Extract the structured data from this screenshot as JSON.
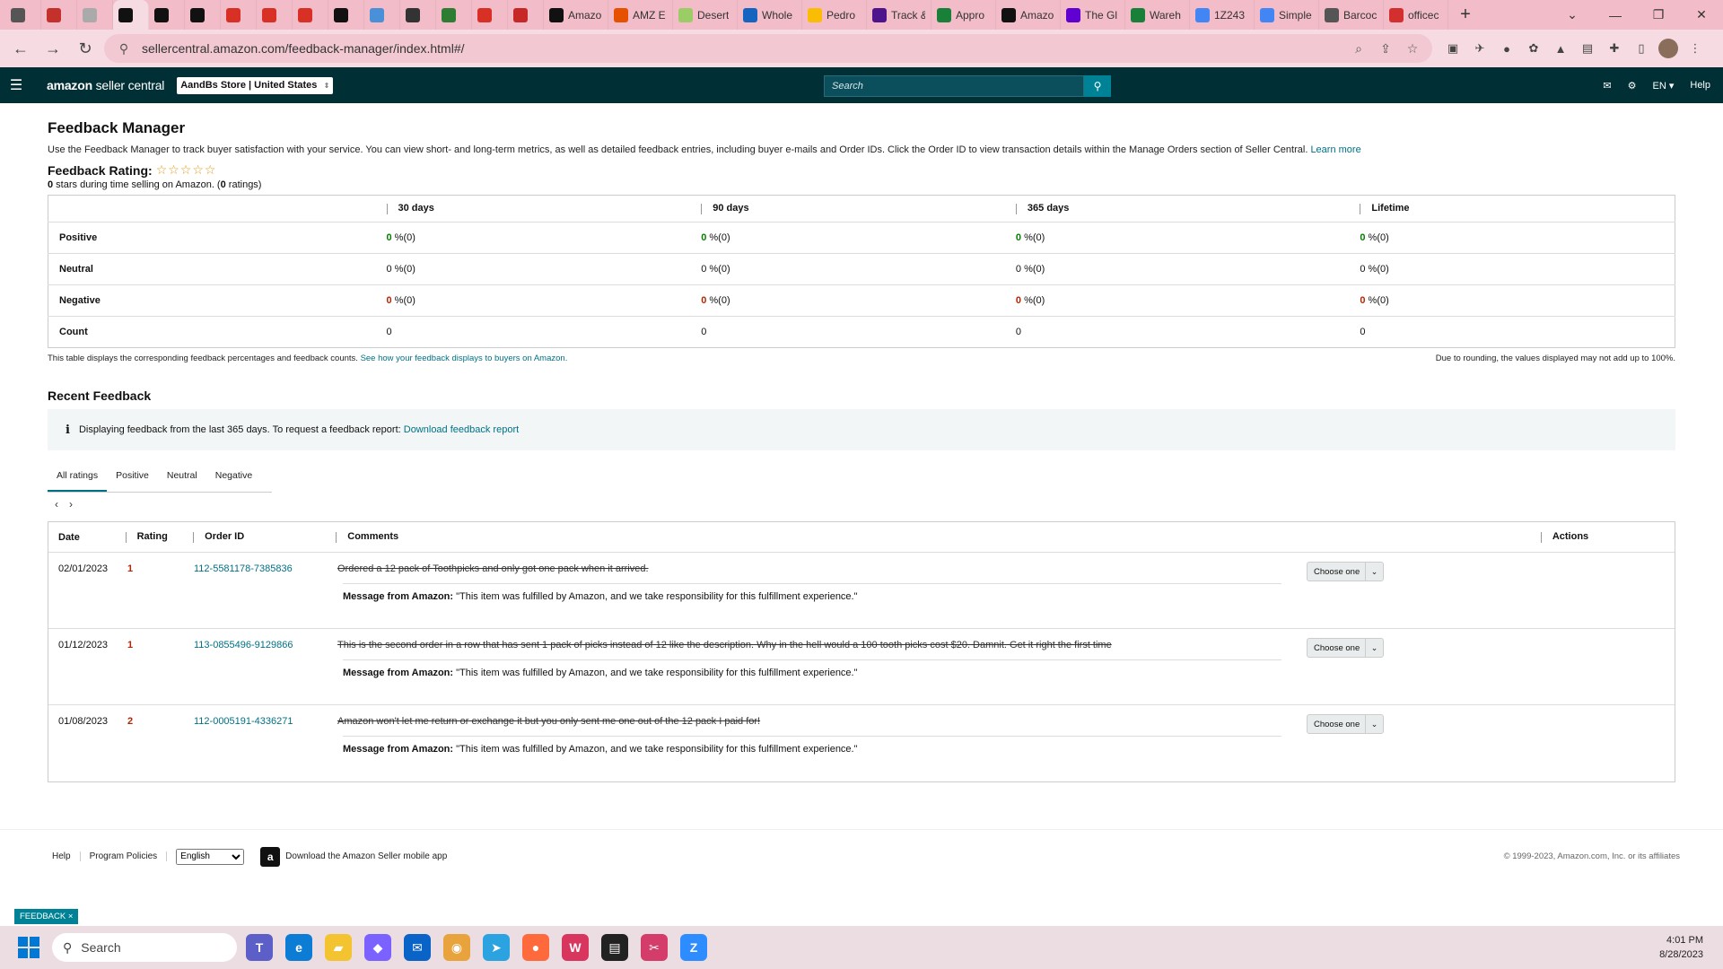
{
  "browser": {
    "tabs": [
      {
        "title": "",
        "icon": "chrome-icon",
        "color": "#555"
      },
      {
        "title": "",
        "icon": "pinterest-like-icon",
        "color": "#c4302b"
      },
      {
        "title": "",
        "icon": "tab-icon",
        "color": "#aaa"
      },
      {
        "title": "",
        "icon": "amazon-icon",
        "color": "#111"
      },
      {
        "title": "",
        "icon": "amazon-icon",
        "color": "#111"
      },
      {
        "title": "",
        "icon": "amazon-icon",
        "color": "#111"
      },
      {
        "title": "",
        "icon": "gmail-icon",
        "color": "#d93025"
      },
      {
        "title": "",
        "icon": "gmail-icon",
        "color": "#d93025"
      },
      {
        "title": "",
        "icon": "gmail-icon",
        "color": "#d93025"
      },
      {
        "title": "",
        "icon": "circle-icon",
        "color": "#111"
      },
      {
        "title": "",
        "icon": "doc-icon",
        "color": "#4a90d9"
      },
      {
        "title": "",
        "icon": "hat-icon",
        "color": "#333"
      },
      {
        "title": "",
        "icon": "leaf-icon",
        "color": "#2e7d32"
      },
      {
        "title": "",
        "icon": "gmail-icon",
        "color": "#d93025"
      },
      {
        "title": "",
        "icon": "box-icon",
        "color": "#c62828"
      },
      {
        "title": "Amazo",
        "icon": "amazon-icon",
        "color": "#111"
      },
      {
        "title": "AMZ E",
        "icon": "pencil-icon",
        "color": "#e65100"
      },
      {
        "title": "Desert",
        "icon": "leaf-icon",
        "color": "#9ccc65"
      },
      {
        "title": "Whole",
        "icon": "windows-icon",
        "color": "#1565c0"
      },
      {
        "title": "Pedro",
        "icon": "drive-icon",
        "color": "#fbbc04"
      },
      {
        "title": "Track &",
        "icon": "fedex-icon",
        "color": "#4d148c"
      },
      {
        "title": "Appro",
        "icon": "sheets-icon",
        "color": "#188038"
      },
      {
        "title": "Amazo",
        "icon": "amazon-icon",
        "color": "#111"
      },
      {
        "title": "The Gl",
        "icon": "yahoo-icon",
        "color": "#6001d2"
      },
      {
        "title": "Wareh",
        "icon": "sheets-icon",
        "color": "#188038"
      },
      {
        "title": "1Z243",
        "icon": "google-icon",
        "color": "#4285f4"
      },
      {
        "title": "Simple",
        "icon": "google-icon",
        "color": "#4285f4"
      },
      {
        "title": "Barcoc",
        "icon": "barcode-icon",
        "color": "#555"
      },
      {
        "title": "officec",
        "icon": "shield-icon",
        "color": "#d32f2f"
      }
    ],
    "url": "sellercentral.amazon.com/feedback-manager/index.html#/"
  },
  "header": {
    "brand_bold": "amazon",
    "brand_rest": " seller central",
    "store": "AandBs Store | United States",
    "search_placeholder": "Search",
    "language": "EN",
    "help": "Help"
  },
  "page": {
    "title": "Feedback Manager",
    "intro": "Use the Feedback Manager to track buyer satisfaction with your service. You can view short- and long-term metrics, as well as detailed feedback entries, including buyer e-mails and Order IDs. Click the Order ID to view transaction details within the Manage Orders section of Seller Central.",
    "learn_more": "Learn more",
    "rating_label": "Feedback Rating:",
    "rating_stars": "☆☆☆☆☆",
    "rating_value": 0,
    "rating_sub_bold": "0",
    "rating_sub_mid": " stars during time selling on Amazon. (",
    "rating_sub_count": "0",
    "rating_sub_end": " ratings)"
  },
  "metrics": {
    "periods": [
      "30 days",
      "90 days",
      "365 days",
      "Lifetime"
    ],
    "rows": [
      {
        "label": "Positive",
        "type": "pos",
        "values": [
          [
            "0",
            " %(0)"
          ],
          [
            "0",
            " %(0)"
          ],
          [
            "0",
            " %(0)"
          ],
          [
            "0",
            " %(0)"
          ]
        ]
      },
      {
        "label": "Neutral",
        "type": "neu",
        "values": [
          [
            "0",
            " %(0)"
          ],
          [
            "0",
            " %(0)"
          ],
          [
            "0",
            " %(0)"
          ],
          [
            "0",
            " %(0)"
          ]
        ]
      },
      {
        "label": "Negative",
        "type": "neg",
        "values": [
          [
            "0",
            " %(0)"
          ],
          [
            "0",
            " %(0)"
          ],
          [
            "0",
            " %(0)"
          ],
          [
            "0",
            " %(0)"
          ]
        ]
      },
      {
        "label": "Count",
        "type": "count",
        "values": [
          [
            "0",
            ""
          ],
          [
            "0",
            ""
          ],
          [
            "0",
            ""
          ],
          [
            "0",
            ""
          ]
        ]
      }
    ],
    "note_left": "This table displays the corresponding feedback percentages and feedback counts.",
    "note_link": "See how your feedback displays to buyers on Amazon.",
    "note_right": "Due to rounding, the values displayed may not add up to 100%."
  },
  "recent": {
    "title": "Recent Feedback",
    "info": "Displaying feedback from the last 365 days. To request a feedback report:",
    "info_link": "Download feedback report",
    "tabs": [
      "All ratings",
      "Positive",
      "Neutral",
      "Negative"
    ],
    "active_tab": 0,
    "columns": {
      "date": "Date",
      "rating": "Rating",
      "order": "Order ID",
      "comments": "Comments",
      "actions": "Actions"
    },
    "rows": [
      {
        "date": "02/01/2023",
        "rating": "1",
        "order_id": "112-5581178-7385836",
        "comment": "Ordered a 12 pack of Toothpicks and only got one pack when it arrived.",
        "message_label": "Message from Amazon:",
        "message": " \"This item was fulfilled by Amazon, and we take responsibility for this fulfillment experience.\"",
        "action": "Choose one"
      },
      {
        "date": "01/12/2023",
        "rating": "1",
        "order_id": "113-0855496-9129866",
        "comment": "This is the second order in a row that has sent 1 pack of picks instead of 12 like the description. Why in the hell would a 100 tooth picks cost $20. Damnit. Get it right the first time",
        "message_label": "Message from Amazon:",
        "message": " \"This item was fulfilled by Amazon, and we take responsibility for this fulfillment experience.\"",
        "action": "Choose one"
      },
      {
        "date": "01/08/2023",
        "rating": "2",
        "order_id": "112-0005191-4336271",
        "comment": "Amazon won't let me return or exchange it but you only sent me one out of the 12 pack I paid for!",
        "message_label": "Message from Amazon:",
        "message": " \"This item was fulfilled by Amazon, and we take responsibility for this fulfillment experience.\"",
        "action": "Choose one"
      }
    ]
  },
  "footer": {
    "help": "Help",
    "program_policies": "Program Policies",
    "language": "English",
    "app_text": "Download the Amazon Seller mobile app",
    "copyright": "© 1999-2023, Amazon.com, Inc. or its affiliates"
  },
  "feedback_tag": "FEEDBACK ×",
  "taskbar": {
    "search": "Search",
    "time": "4:01 PM",
    "date": "8/28/2023"
  },
  "colors": {
    "header_bg": "#002f36",
    "accent": "#008296",
    "link": "#007185",
    "positive": "#067d00",
    "negative": "#b12704",
    "tabstrip": "#f2bcc8"
  }
}
